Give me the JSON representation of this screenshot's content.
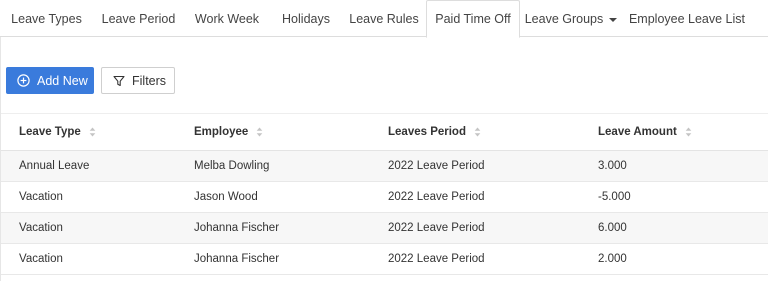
{
  "tabs": [
    {
      "label": "Leave Types"
    },
    {
      "label": "Leave Period"
    },
    {
      "label": "Work Week"
    },
    {
      "label": "Holidays"
    },
    {
      "label": "Leave Rules"
    },
    {
      "label": "Paid Time Off",
      "active": true
    },
    {
      "label": "Leave Groups"
    },
    {
      "label": "Employee Leave List"
    }
  ],
  "toolbar": {
    "add_label": "Add New",
    "filter_label": "Filters"
  },
  "table": {
    "columns": [
      "Leave Type",
      "Employee",
      "Leaves Period",
      "Leave Amount"
    ],
    "rows": [
      [
        "Annual Leave",
        "Melba Dowling",
        "2022 Leave Period",
        "3.000"
      ],
      [
        "Vacation",
        "Jason Wood",
        "2022 Leave Period",
        "-5.000"
      ],
      [
        "Vacation",
        "Johanna Fischer",
        "2022 Leave Period",
        "6.000"
      ],
      [
        "Vacation",
        "Johanna Fischer",
        "2022 Leave Period",
        "2.000"
      ]
    ]
  },
  "colors": {
    "accent": "#3a7bdc",
    "row_stripe": "#f7f7f7",
    "border": "#dddddd"
  },
  "icons": {
    "add": "plus-circle-icon",
    "filter": "funnel-icon",
    "sort": "sort-icon",
    "dropdown": "caret-down-icon"
  }
}
